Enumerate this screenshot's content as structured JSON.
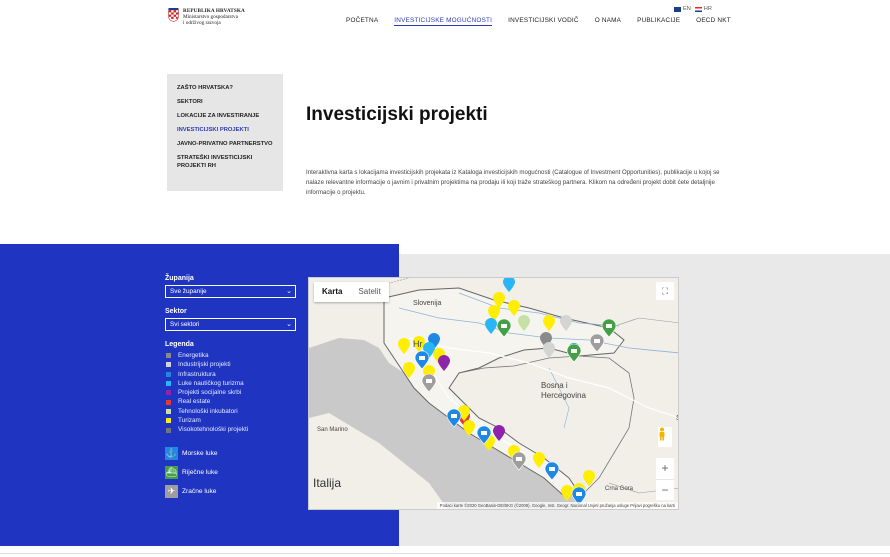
{
  "header": {
    "logo_line1": "REPUBLIKA HRVATSKA",
    "logo_line2": "Ministarstvo gospodarstva",
    "logo_line3": "i održivog razvoja",
    "nav": [
      "POČETNA",
      "INVESTICIJSKE MOGUĆNOSTI",
      "INVESTICIJSKI VODIČ",
      "O NAMA",
      "PUBLIKACIJE",
      "OECD NKT"
    ],
    "nav_active_index": 1,
    "lang_en": "EN",
    "lang_hr": "HR"
  },
  "sidebar": {
    "items": [
      "ZAŠTO HRVATSKA?",
      "SEKTORI",
      "LOKACIJE ZA INVESTIRANJE",
      "INVESTICIJSKI PROJEKTI",
      "JAVNO-PRIVATNO PARTNERSTVO",
      "STRATEŠKI INVESTICIJSKI PROJEKTI RH"
    ],
    "active_index": 3
  },
  "main": {
    "title": "Investicijski projekti",
    "intro": "Interaktivna karta s lokacijama investicijskih projekata iz Kataloga investicijskih mogućnosti (Catalogue of Investment Opportunities), publikacije u kojoj se nalaze relevantne informacije o javnim i privatnim projektima na prodaju ili koji traže strateškog partnera. Klikom na određeni projekt dobit ćete detaljnije informacije o projektu."
  },
  "filters": {
    "county_label": "Županija",
    "county_value": "Sve županije",
    "sector_label": "Sektor",
    "sector_value": "Svi sektori",
    "legend_title": "Legenda",
    "legend": [
      {
        "label": "Energetika",
        "color": "#8a8a8a"
      },
      {
        "label": "Industrijski projekti",
        "color": "#d4d4d4"
      },
      {
        "label": "Infrastruktura",
        "color": "#1e88e5"
      },
      {
        "label": "Luke nautičkog turizma",
        "color": "#29b6f6"
      },
      {
        "label": "Projekti socijalne skrbi",
        "color": "#8e24aa"
      },
      {
        "label": "Real estate",
        "color": "#e53935"
      },
      {
        "label": "Tehnološki inkubatori",
        "color": "#c5e1a5"
      },
      {
        "label": "Turizam",
        "color": "#ffee00"
      },
      {
        "label": "Visokotehnološki projekti",
        "color": "#757575"
      }
    ],
    "ports": [
      {
        "label": "Morske luke",
        "icon": "anchor-icon",
        "color": "#1e88e5"
      },
      {
        "label": "Riječne luke",
        "icon": "ship-icon",
        "color": "#43a047"
      },
      {
        "label": "Zračne luke",
        "icon": "plane-icon",
        "color": "#9e9e9e"
      }
    ]
  },
  "map": {
    "tab_map": "Karta",
    "tab_satellite": "Satelit",
    "labels": {
      "slovenia": "Slovenija",
      "hr": "Hr",
      "bosnia1": "Bosna i",
      "bosnia2": "Hercegovina",
      "sanmarino": "San Marino",
      "italy": "Italija",
      "cg": "Crna Gora",
      "s": "S"
    },
    "attribution": "Podaci karte ©2020 GeoBasis-DE/BKG (©2009), Google, Inst. Geogr. Nacional   Uvjeti pružanja usluge   Prijavi pogrešku na karti",
    "zoom_in": "+",
    "zoom_out": "−"
  }
}
